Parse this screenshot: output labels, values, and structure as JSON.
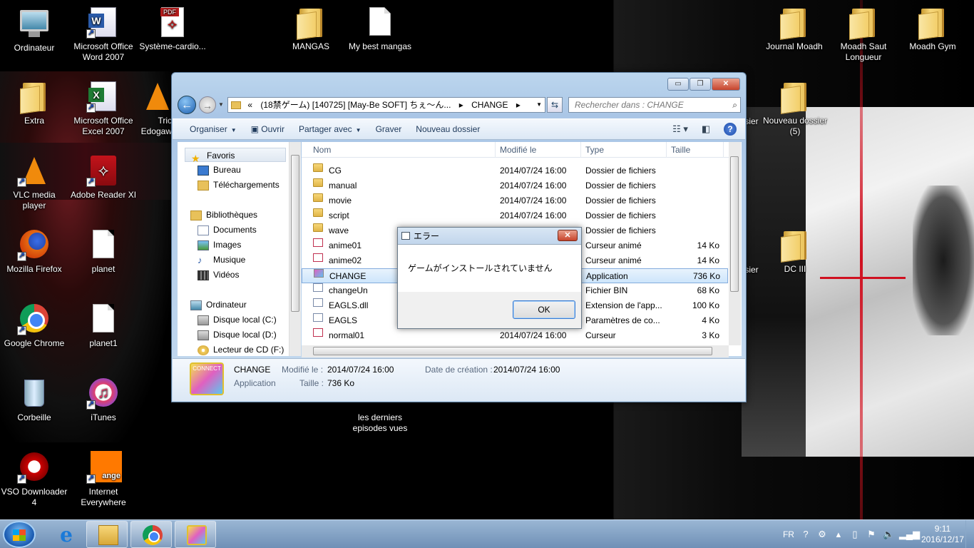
{
  "desktop": {
    "icons": [
      {
        "label": "Ordinateur",
        "icon": "computer-icon"
      },
      {
        "label": "Microsoft Office Word 2007",
        "icon": "word-icon"
      },
      {
        "label": "Système-cardio...",
        "icon": "pdf-icon",
        "badge": "PDF"
      },
      {
        "label": "MANGAS",
        "icon": "folder-icon"
      },
      {
        "label": "My best mangas",
        "icon": "document-icon"
      },
      {
        "label": "Journal Moadh",
        "icon": "folder-icon"
      },
      {
        "label": "Moadh Saut Longueur",
        "icon": "folder-icon"
      },
      {
        "label": "Moadh Gym",
        "icon": "folder-icon"
      },
      {
        "label": "Extra",
        "icon": "folder-icon"
      },
      {
        "label": "Microsoft Office Excel 2007",
        "icon": "excel-icon"
      },
      {
        "label": "Tric Edogaw",
        "icon": "vlc-icon"
      },
      {
        "label": "Nouveau dossier (5)",
        "icon": "folder-icon"
      },
      {
        "label": "VLC media player",
        "icon": "vlc-icon"
      },
      {
        "label": "Adobe Reader XI",
        "icon": "adobe-reader-icon"
      },
      {
        "label": "Mozilla Firefox",
        "icon": "firefox-icon"
      },
      {
        "label": "planet",
        "icon": "document-icon"
      },
      {
        "label": "DC III",
        "icon": "folder-icon"
      },
      {
        "label": "Google Chrome",
        "icon": "chrome-icon"
      },
      {
        "label": "planet1",
        "icon": "document-icon"
      },
      {
        "label": "Corbeille",
        "icon": "recycle-bin-icon"
      },
      {
        "label": "iTunes",
        "icon": "itunes-icon"
      },
      {
        "label": "les derniers episodes vues",
        "icon": "document-icon"
      },
      {
        "label": "VSO Downloader 4",
        "icon": "vso-icon"
      },
      {
        "label": "Internet Everywhere",
        "icon": "orange-icon",
        "badge": "ange"
      }
    ],
    "partial_labels": [
      "sier",
      "sier"
    ]
  },
  "explorer": {
    "window_buttons": {
      "minimize": "▭",
      "maximize": "❐",
      "close": "✕"
    },
    "address": {
      "prefix": "«",
      "path": "(18禁ゲーム) [140725] [May-Be SOFT] ちぇ〜ん...",
      "separator": "▸",
      "current": "CHANGE",
      "end": "▸"
    },
    "search_placeholder": "Rechercher dans : CHANGE",
    "toolbar": {
      "organize": "Organiser",
      "open": "Ouvrir",
      "share": "Partager avec",
      "burn": "Graver",
      "new_folder": "Nouveau dossier"
    },
    "nav": {
      "favorites": "Favoris",
      "desktop": "Bureau",
      "downloads": "Téléchargements",
      "libraries": "Bibliothèques",
      "documents": "Documents",
      "images": "Images",
      "music": "Musique",
      "videos": "Vidéos",
      "computer": "Ordinateur",
      "disk_c": "Disque local (C:)",
      "disk_d": "Disque local (D:)",
      "cd_f": "Lecteur de CD (F:)"
    },
    "columns": {
      "name": "Nom",
      "modified": "Modifié le",
      "type": "Type",
      "size": "Taille"
    },
    "files": [
      {
        "name": "CG",
        "modified": "2014/07/24 16:00",
        "type": "Dossier de fichiers",
        "size": "",
        "kind": "folder"
      },
      {
        "name": "manual",
        "modified": "2014/07/24 16:00",
        "type": "Dossier de fichiers",
        "size": "",
        "kind": "folder"
      },
      {
        "name": "movie",
        "modified": "2014/07/24 16:00",
        "type": "Dossier de fichiers",
        "size": "",
        "kind": "folder"
      },
      {
        "name": "script",
        "modified": "2014/07/24 16:00",
        "type": "Dossier de fichiers",
        "size": "",
        "kind": "folder"
      },
      {
        "name": "wave",
        "modified": "",
        "type": "Dossier de fichiers",
        "size": "",
        "kind": "folder"
      },
      {
        "name": "anime01",
        "modified": "",
        "type": "Curseur animé",
        "size": "14 Ko",
        "kind": "cursor"
      },
      {
        "name": "anime02",
        "modified": "",
        "type": "Curseur animé",
        "size": "14 Ko",
        "kind": "cursor"
      },
      {
        "name": "CHANGE",
        "modified": "",
        "type": "Application",
        "size": "736 Ko",
        "kind": "app",
        "selected": true
      },
      {
        "name": "changeUn",
        "modified": "",
        "type": "Fichier BIN",
        "size": "68 Ko",
        "kind": "file"
      },
      {
        "name": "EAGLS.dll",
        "modified": "",
        "type": "Extension de l'app...",
        "size": "100 Ko",
        "kind": "file"
      },
      {
        "name": "EAGLS",
        "modified": "",
        "type": "Paramètres de co...",
        "size": "4 Ko",
        "kind": "file"
      },
      {
        "name": "normal01",
        "modified": "2014/07/24 16:00",
        "type": "Curseur",
        "size": "3 Ko",
        "kind": "cursor"
      }
    ],
    "details": {
      "name": "CHANGE",
      "type": "Application",
      "modified_label": "Modifié le :",
      "modified": "2014/07/24 16:00",
      "created_label": "Date de création :",
      "created": "2014/07/24 16:00",
      "size_label": "Taille :",
      "size": "736 Ko",
      "thumb_text": "CONNECT"
    }
  },
  "dialog": {
    "title": "エラー",
    "message": "ゲームがインストールされていません",
    "ok": "OK",
    "close": "✕"
  },
  "taskbar": {
    "lang": "FR",
    "time": "9:11",
    "date": "2016/12/17"
  }
}
